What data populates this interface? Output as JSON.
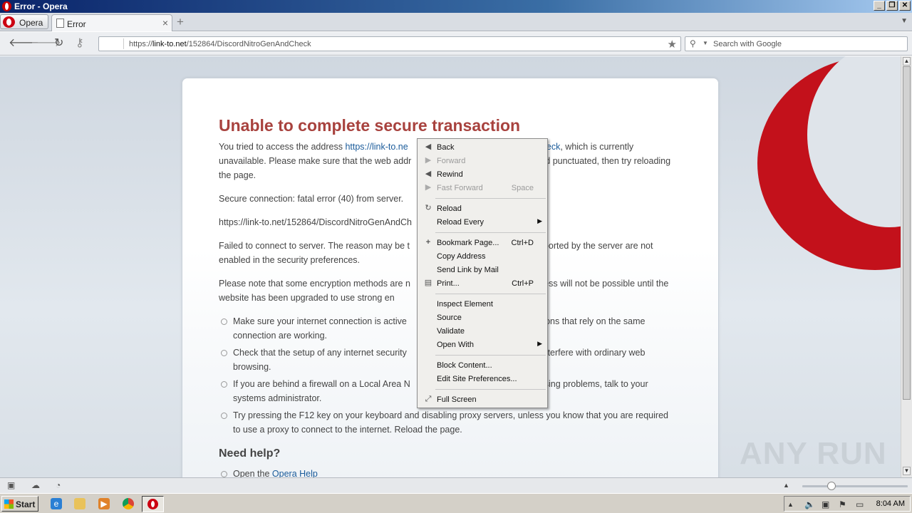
{
  "window": {
    "title": "Error - Opera"
  },
  "tabs": {
    "opera_menu_label": "Opera",
    "active_tab_label": "Error"
  },
  "address_bar": {
    "url_prefix": "https://",
    "url_host": "link-to.net",
    "url_path": "/152864/DiscordNitroGenAndCheck",
    "search_placeholder": "Search with Google"
  },
  "error_page": {
    "heading": "Unable to complete secure transaction",
    "para1_a": "You tried to access the address ",
    "para1_link_a": "https://link-to.ne",
    "para1_gap": "",
    "para1_link_b": "check",
    "para1_b": ", which is currently unavailable. Please make sure that the web addr",
    "para1_c": "nd punctuated, then try reloading the page.",
    "para2": "Secure connection: fatal error (40) from server.",
    "para3": "https://link-to.net/152864/DiscordNitroGenAndCh",
    "para4_a": "Failed to connect to server. The reason may be t",
    "para4_b": "pported by the server are not enabled in the security preferences.",
    "para5_a": "Please note that some encryption methods are n",
    "para5_b": "cess will not be possible until the website has been upgraded to use strong en",
    "tips": [
      {
        "a": "Make sure your internet connection is active",
        "b": "ations that rely on the same connection are working."
      },
      {
        "a": "Check that the setup of any internet security",
        "b": "t interfere with ordinary web browsing."
      },
      {
        "a": "If you are behind a firewall on a Local Area N",
        "b": "using problems, talk to your systems administrator."
      },
      {
        "a": "Try pressing the F12 key on your keyboard and disabling proxy servers, unless you know that you are required to use a proxy to connect to the internet. Reload the page.",
        "b": ""
      }
    ],
    "help_heading": "Need help?",
    "help_text": "Open the ",
    "help_link": "Opera Help"
  },
  "context_menu": {
    "back": "Back",
    "forward": "Forward",
    "rewind": "Rewind",
    "fast_forward": "Fast Forward",
    "fast_forward_shortcut": "Space",
    "reload": "Reload",
    "reload_every": "Reload Every",
    "bookmark_page": "Bookmark Page...",
    "bookmark_shortcut": "Ctrl+D",
    "copy_address": "Copy Address",
    "send_link": "Send Link by Mail",
    "print": "Print...",
    "print_shortcut": "Ctrl+P",
    "inspect": "Inspect Element",
    "source": "Source",
    "validate": "Validate",
    "open_with": "Open With",
    "block_content": "Block Content...",
    "edit_site_prefs": "Edit Site Preferences...",
    "full_screen": "Full Screen"
  },
  "taskbar": {
    "start_label": "Start",
    "clock": "8:04 AM"
  },
  "watermark": "ANY RUN",
  "colors": {
    "heading": "#a8423e",
    "link": "#1a5b9a",
    "opera_red": "#c3111b"
  }
}
